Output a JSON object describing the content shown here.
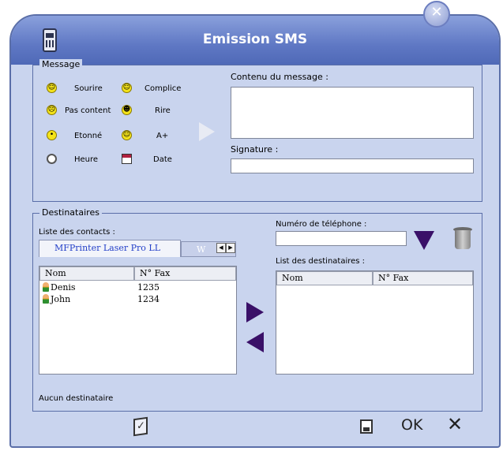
{
  "window": {
    "title": "Emission SMS",
    "close_symbol": "✕"
  },
  "message": {
    "legend": "Message",
    "emoticons": [
      {
        "label": "Sourire",
        "face": "☺"
      },
      {
        "label": "Complice",
        "face": "☺"
      },
      {
        "label": "Pas content",
        "face": "☹"
      },
      {
        "label": "Rire",
        "face": "☻"
      },
      {
        "label": "Etonné",
        "face": "•"
      },
      {
        "label": "A+",
        "face": "☺"
      },
      {
        "label": "Heure",
        "icon": "clock-icon"
      },
      {
        "label": "Date",
        "icon": "calendar-icon"
      }
    ],
    "content_label": "Contenu du message :",
    "content_value": "",
    "signature_label": "Signature :",
    "signature_value": ""
  },
  "recipients": {
    "legend": "Destinataires",
    "contacts_label": "Liste des contacts :",
    "tabs": [
      "MFPrinter Laser Pro LL",
      "W"
    ],
    "contacts_columns": [
      "Nom",
      "N° Fax"
    ],
    "contacts": [
      {
        "name": "Denis",
        "fax": "1235"
      },
      {
        "name": "John",
        "fax": "1234"
      }
    ],
    "phone_label": "Numéro de téléphone :",
    "phone_value": "",
    "dest_label": "List des destinataires :",
    "dest_columns": [
      "Nom",
      "N° Fax"
    ],
    "status": "Aucun destinataire"
  },
  "footer": {
    "ok_label": "OK",
    "cancel_symbol": "✕"
  },
  "colors": {
    "window_bg": "#c9d4ee",
    "title_bar": "#5f78c4",
    "accent_arrow": "#3a1068",
    "tab_text": "#2440c8"
  }
}
